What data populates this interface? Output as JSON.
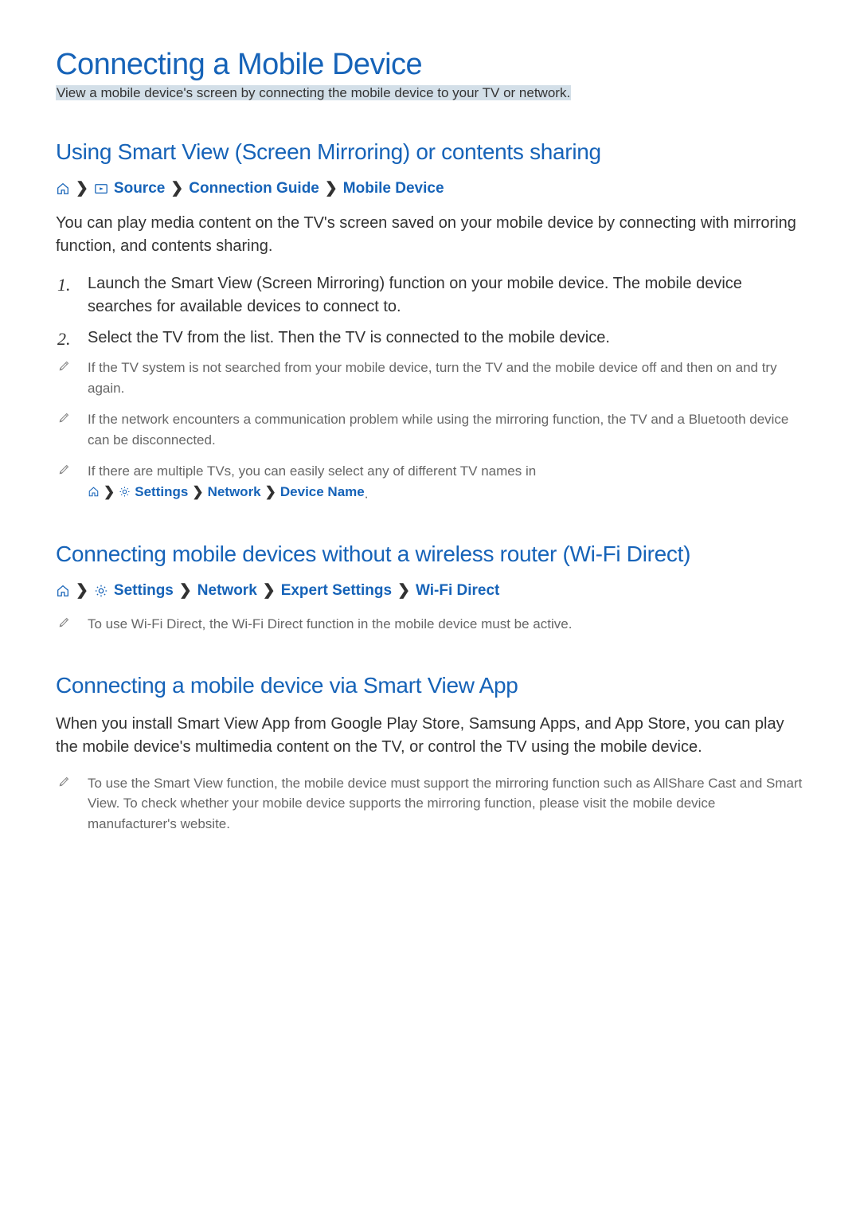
{
  "page": {
    "title": "Connecting a Mobile Device",
    "subtitle": "View a mobile device's screen by connecting the mobile device to your TV or network."
  },
  "section1": {
    "heading": "Using Smart View (Screen Mirroring) or contents sharing",
    "bc": {
      "source": "Source",
      "connection_guide": "Connection Guide",
      "mobile_device": "Mobile Device"
    },
    "intro": "You can play media content on the TV's screen saved on your mobile device by connecting with mirroring function, and contents sharing.",
    "step1": "Launch the Smart View (Screen Mirroring) function on your mobile device. The mobile device searches for available devices to connect to.",
    "step2": "Select the TV from the list. Then the TV is connected to the mobile device.",
    "note1": "If the TV system is not searched from your mobile device, turn the TV and the mobile device off and then on and try again.",
    "note2": "If the network encounters a communication problem while using the mirroring function, the TV and a Bluetooth device can be disconnected.",
    "note3_pre": "If there are multiple TVs, you can easily select any of different TV names in ",
    "note3_bc": {
      "settings": "Settings",
      "network": "Network",
      "device_name": "Device Name"
    },
    "note3_post": "."
  },
  "section2": {
    "heading": "Connecting mobile devices without a wireless router (Wi-Fi Direct)",
    "bc": {
      "settings": "Settings",
      "network": "Network",
      "expert": "Expert Settings",
      "wifi_direct": "Wi-Fi Direct"
    },
    "note1": "To use Wi-Fi Direct, the Wi-Fi Direct function in the mobile device must be active."
  },
  "section3": {
    "heading": "Connecting a mobile device via Smart View App",
    "body": "When you install Smart View App from Google Play Store, Samsung Apps, and App Store, you can play the mobile device's multimedia content on the TV, or control the TV using the mobile device.",
    "note1": "To use the Smart View function, the mobile device must support the mirroring function such as AllShare Cast and Smart View. To check whether your mobile device supports the mirroring function, please visit the mobile device manufacturer's website."
  }
}
